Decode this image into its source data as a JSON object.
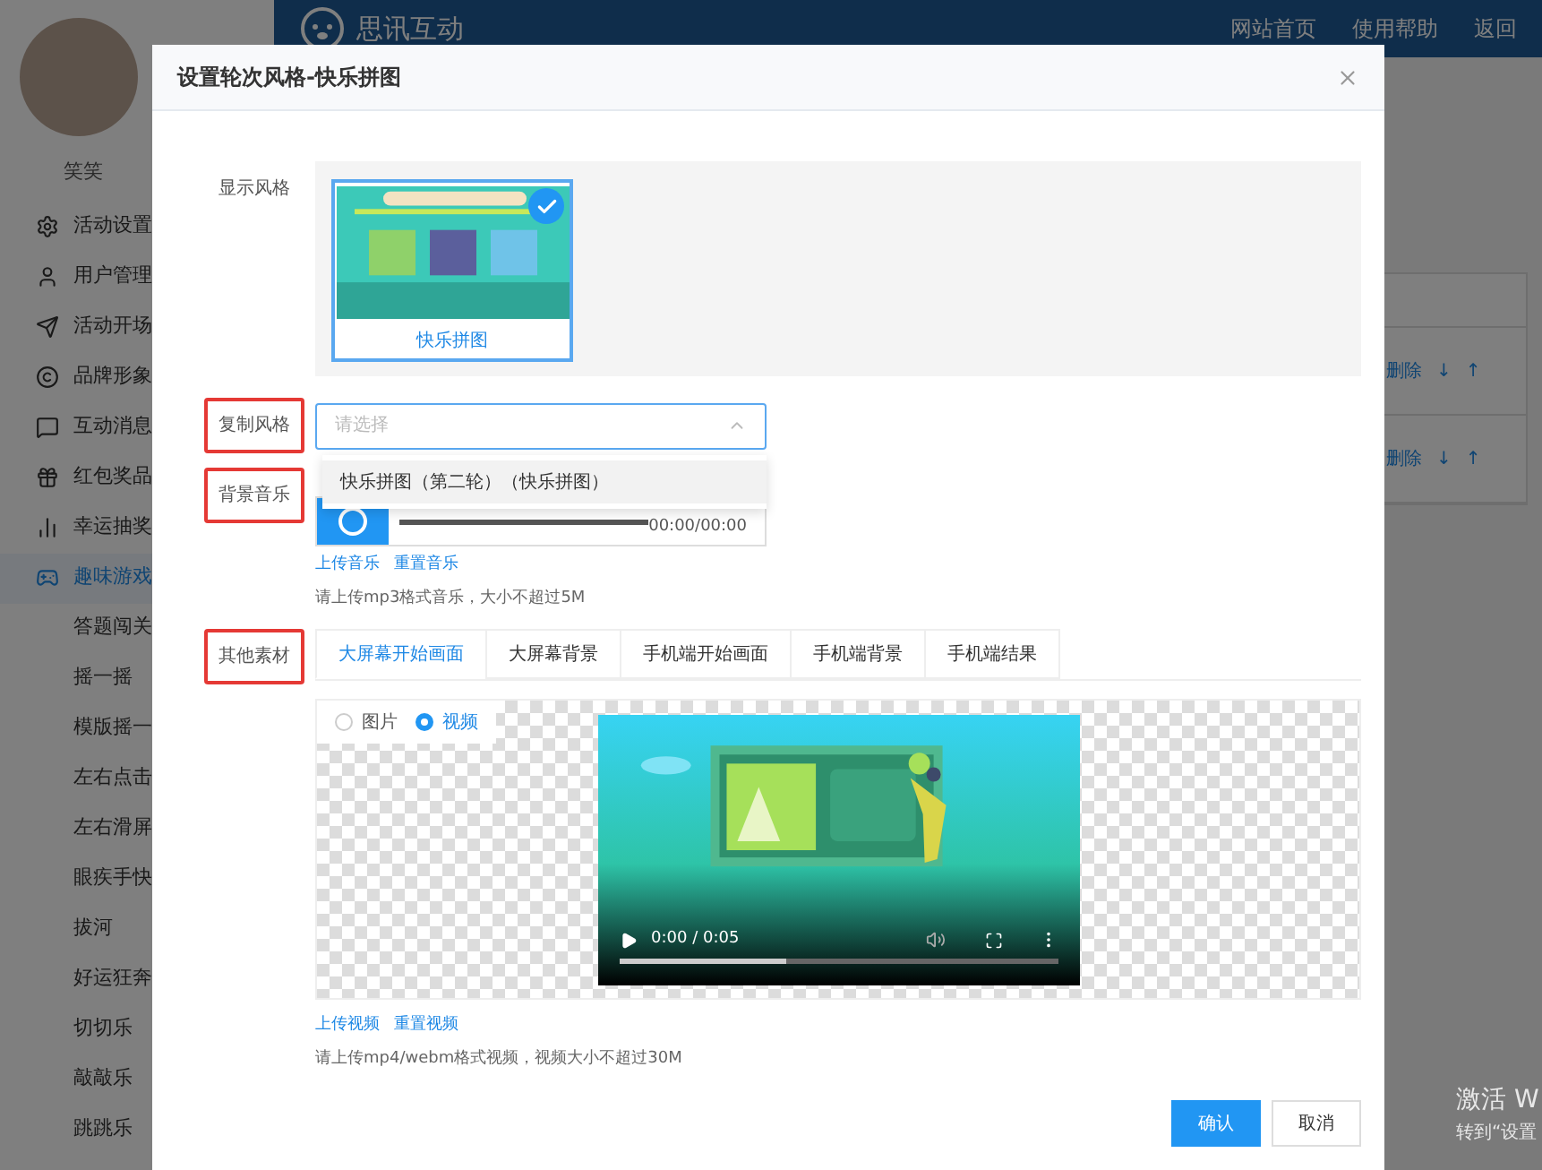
{
  "header": {
    "logo": "思讯互动",
    "nav": [
      "网站首页",
      "使用帮助",
      "返回"
    ]
  },
  "sidebar": {
    "user_name": "笑笑",
    "items": [
      {
        "label": "活动设置",
        "selected": false
      },
      {
        "label": "用户管理",
        "selected": false
      },
      {
        "label": "活动开场",
        "selected": false
      },
      {
        "label": "品牌形象",
        "selected": false
      },
      {
        "label": "互动消息",
        "selected": false
      },
      {
        "label": "红包奖品",
        "selected": false
      },
      {
        "label": "幸运抽奖",
        "selected": false
      },
      {
        "label": "趣味游戏",
        "selected": true,
        "children": [
          {
            "label": "答题闯关",
            "selected": false
          },
          {
            "label": "摇一摇",
            "selected": false
          },
          {
            "label": "模版摇一",
            "selected": false
          },
          {
            "label": "左右点击",
            "selected": false
          },
          {
            "label": "左右滑屏",
            "selected": false
          },
          {
            "label": "眼疾手快",
            "selected": false
          },
          {
            "label": "拔河",
            "selected": false
          },
          {
            "label": "好运狂奔",
            "selected": false
          },
          {
            "label": "切切乐",
            "selected": false
          },
          {
            "label": "敲敲乐",
            "selected": false
          },
          {
            "label": "跳跳乐",
            "selected": false
          }
        ]
      }
    ]
  },
  "table": {
    "rows": [
      {
        "actions": [
          "删除",
          "↓",
          "↑"
        ]
      },
      {
        "actions": [
          "删除",
          "↓",
          "↑"
        ]
      }
    ]
  },
  "os_notice": [
    "激活 W",
    "转到“设置"
  ],
  "modal": {
    "title": "设置轮次风格-快乐拼图",
    "style_section": {
      "label": "显示风格",
      "highlighted": false,
      "styles": [
        {
          "label": "快乐拼图",
          "selected": true
        }
      ]
    },
    "copy_style": {
      "label": "复制风格",
      "highlighted": true,
      "placeholder": "请选择",
      "expanded": true,
      "options": [
        {
          "label": "快乐拼图（第二轮）（快乐拼图）",
          "hovered": true
        }
      ]
    },
    "music": {
      "label": "背景音乐",
      "highlighted": true,
      "time": "00:00/00:00",
      "links": [
        "上传音乐",
        "重置音乐"
      ],
      "hint": "请上传mp3格式音乐，大小不超过5M"
    },
    "materials": {
      "label": "其他素材",
      "highlighted": true,
      "tabs": [
        {
          "label": "大屏幕开始画面",
          "selected": true
        },
        {
          "label": "大屏幕背景",
          "selected": false
        },
        {
          "label": "手机端开始画面",
          "selected": false
        },
        {
          "label": "手机端背景",
          "selected": false
        },
        {
          "label": "手机端结果",
          "selected": false
        }
      ],
      "media_types": [
        {
          "label": "图片",
          "selected": false
        },
        {
          "label": "视频",
          "selected": true
        }
      ],
      "video": {
        "time": "0:00 / 0:05",
        "level": 0.38
      },
      "links": [
        "上传视频",
        "重置视频"
      ],
      "hint": "请上传mp4/webm格式视频，视频大小不超过30M"
    },
    "buttons": [
      {
        "label": "确认",
        "kind": "primary"
      },
      {
        "label": "取消",
        "kind": "default"
      }
    ]
  }
}
